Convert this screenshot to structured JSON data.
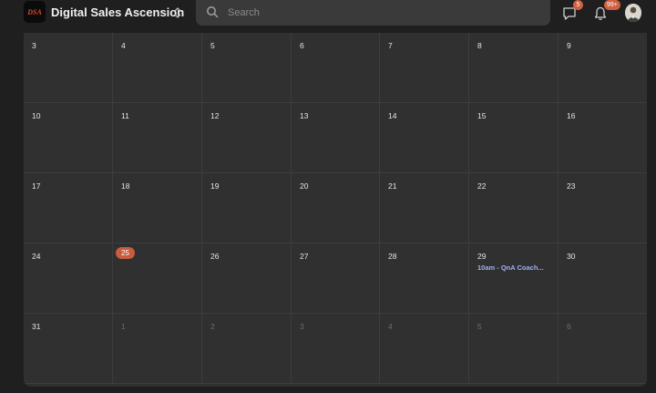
{
  "app": {
    "name": "Digital Sales Ascension",
    "logo_text": "DSA"
  },
  "search": {
    "placeholder": "Search"
  },
  "notifications": {
    "messages_count": "5",
    "alerts_count": "99+"
  },
  "colors": {
    "background": "#1f1f1f",
    "calendar": "#303030",
    "accent": "#c85c3e",
    "event": "#9db1f2"
  },
  "calendar": {
    "weeks": [
      {
        "days": [
          {
            "label": "3",
            "muted": false
          },
          {
            "label": "4",
            "muted": false
          },
          {
            "label": "5",
            "muted": false
          },
          {
            "label": "6",
            "muted": false
          },
          {
            "label": "7",
            "muted": false
          },
          {
            "label": "8",
            "muted": false
          },
          {
            "label": "9",
            "muted": false
          }
        ]
      },
      {
        "days": [
          {
            "label": "10",
            "muted": false
          },
          {
            "label": "11",
            "muted": false
          },
          {
            "label": "12",
            "muted": false
          },
          {
            "label": "13",
            "muted": false
          },
          {
            "label": "14",
            "muted": false
          },
          {
            "label": "15",
            "muted": false
          },
          {
            "label": "16",
            "muted": false
          }
        ]
      },
      {
        "days": [
          {
            "label": "17",
            "muted": false
          },
          {
            "label": "18",
            "muted": false
          },
          {
            "label": "19",
            "muted": false
          },
          {
            "label": "20",
            "muted": false
          },
          {
            "label": "21",
            "muted": false
          },
          {
            "label": "22",
            "muted": false
          },
          {
            "label": "23",
            "muted": false
          }
        ]
      },
      {
        "days": [
          {
            "label": "24",
            "muted": false
          },
          {
            "label": "25",
            "muted": false,
            "today": true
          },
          {
            "label": "26",
            "muted": false
          },
          {
            "label": "27",
            "muted": false
          },
          {
            "label": "28",
            "muted": false
          },
          {
            "label": "29",
            "muted": false,
            "event": "10am - QnA Coach..."
          },
          {
            "label": "30",
            "muted": false
          }
        ]
      },
      {
        "days": [
          {
            "label": "31",
            "muted": false
          },
          {
            "label": "1",
            "muted": true
          },
          {
            "label": "2",
            "muted": true
          },
          {
            "label": "3",
            "muted": true
          },
          {
            "label": "4",
            "muted": true
          },
          {
            "label": "5",
            "muted": true
          },
          {
            "label": "6",
            "muted": true
          }
        ]
      }
    ]
  }
}
